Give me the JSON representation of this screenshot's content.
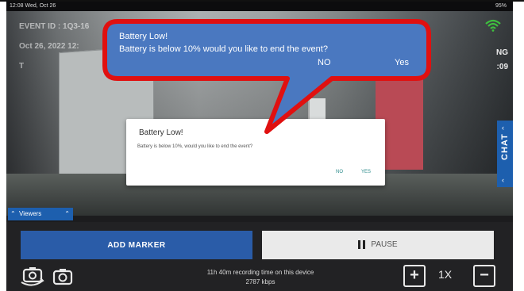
{
  "status_bar": {
    "time_date": "12:08  Wed, Oct 26",
    "right": "95%"
  },
  "event": {
    "id_label": "EVENT ID : 1Q3-16",
    "date_line": "Oct 26, 2022  12:",
    "extra": "T"
  },
  "right_info": {
    "line1": "NG",
    "line2": ":09"
  },
  "chat_tab": {
    "label": "CHAT"
  },
  "viewers": {
    "label": "Viewers"
  },
  "controls": {
    "add_marker": "ADD MARKER",
    "pause": "PAUSE"
  },
  "recording": {
    "time_left": "11h 40m recording time on this device",
    "bitrate": "2787 kbps"
  },
  "zoom": {
    "plus": "+",
    "level": "1X",
    "minus": "−"
  },
  "app_dialog": {
    "title": "Battery Low!",
    "message": "Battery is below 10%, would you like to end the event?",
    "no": "NO",
    "yes": "YES"
  },
  "callout": {
    "title": "Battery Low!",
    "message": "Battery is below 10% would you like to end the event?",
    "no": "NO",
    "yes": "Yes",
    "color": "#4a78c0",
    "border_color": "#e01010"
  }
}
